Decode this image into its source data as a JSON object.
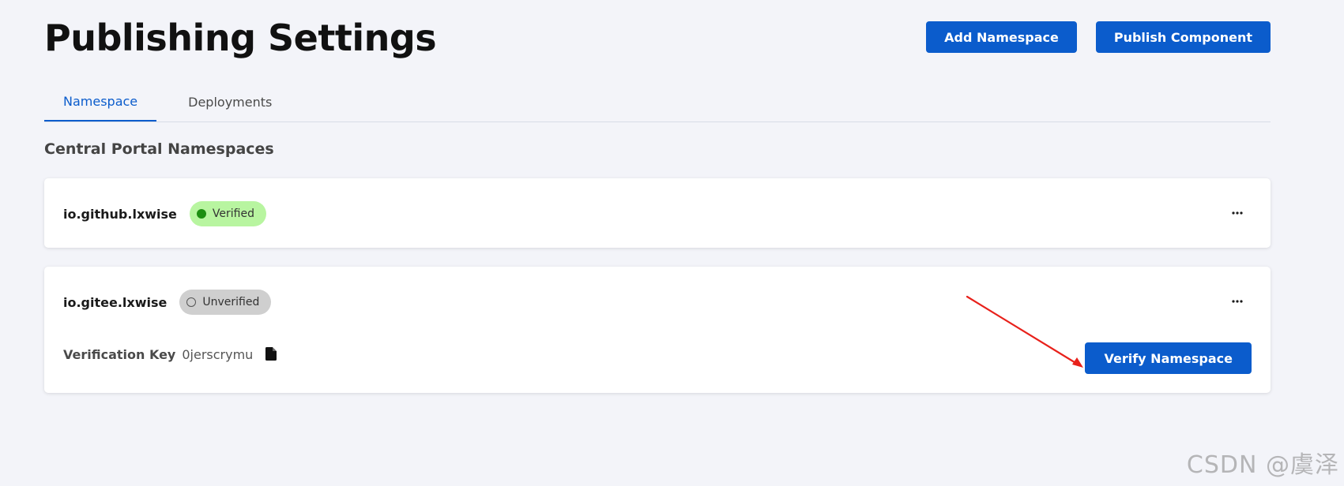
{
  "header": {
    "title": "Publishing Settings",
    "add_namespace_label": "Add Namespace",
    "publish_component_label": "Publish Component"
  },
  "tabs": [
    {
      "label": "Namespace",
      "active": true
    },
    {
      "label": "Deployments",
      "active": false
    }
  ],
  "section": {
    "title": "Central Portal Namespaces"
  },
  "namespaces": [
    {
      "name": "io.github.lxwise",
      "status": "Verified",
      "status_color": "#b8f5a0",
      "status_icon": "filled-circle-icon",
      "menu_icon": "more-horizontal-icon"
    },
    {
      "name": "io.gitee.lxwise",
      "status": "Unverified",
      "status_color": "#cfcfcf",
      "status_icon": "empty-circle-icon",
      "menu_icon": "more-horizontal-icon",
      "verification_key_label": "Verification Key",
      "verification_key_value": "0jerscrymu",
      "copy_icon": "file-icon",
      "verify_button_label": "Verify Namespace"
    }
  ],
  "annotation": {
    "type": "arrow",
    "color": "#e8211b"
  },
  "watermark": {
    "text": "CSDN @虞泽"
  },
  "colors": {
    "primary": "#0b5ccc",
    "background": "#f3f4f9",
    "card": "#ffffff"
  }
}
